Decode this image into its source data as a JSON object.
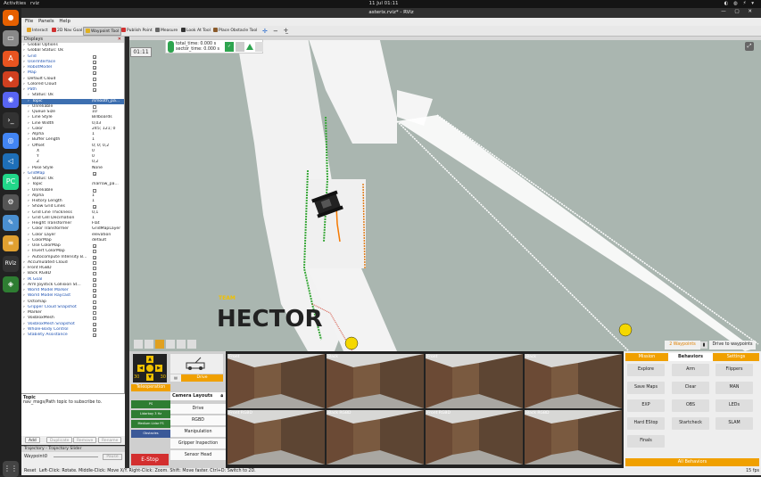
{
  "system": {
    "activities": "Activities",
    "clock": "11 Jul  01:11",
    "app_name": "rviz"
  },
  "window": {
    "title": "asterix.rviz* - RViz"
  },
  "menu": [
    "File",
    "Panels",
    "Help"
  ],
  "toolbar": [
    {
      "label": "Interact",
      "color": "#e0a020",
      "selected": false
    },
    {
      "label": "2D Nav Goal",
      "color": "#d03030",
      "selected": false
    },
    {
      "label": "Waypoint Tool",
      "color": "#e0b020",
      "selected": true
    },
    {
      "label": "Publish Point",
      "color": "#d03030",
      "selected": false
    },
    {
      "label": "Measure",
      "color": "#666666",
      "selected": false
    },
    {
      "label": "Look At Tool",
      "color": "#333333",
      "selected": false
    },
    {
      "label": "Place Obstacle Tool",
      "color": "#8a5a2a",
      "selected": false
    }
  ],
  "displays": {
    "title": "Displays",
    "rows": [
      {
        "indent": 1,
        "label": "Global Options",
        "value": "",
        "check": null,
        "blue": false
      },
      {
        "indent": 1,
        "label": "Global Status: Ok",
        "value": "",
        "check": null,
        "blue": false
      },
      {
        "indent": 1,
        "label": "Grid",
        "value": "",
        "check": true,
        "blue": true
      },
      {
        "indent": 1,
        "label": "UserInterface",
        "value": "",
        "check": true,
        "blue": true
      },
      {
        "indent": 1,
        "label": "RobotModel",
        "value": "",
        "check": true,
        "blue": true
      },
      {
        "indent": 1,
        "label": "Map",
        "value": "",
        "check": true,
        "blue": true
      },
      {
        "indent": 1,
        "label": "Default Cloud",
        "value": "",
        "check": false,
        "blue": false
      },
      {
        "indent": 1,
        "label": "Colored Cloud",
        "value": "",
        "check": false,
        "blue": false
      },
      {
        "indent": 1,
        "label": "Path",
        "value": "",
        "check": true,
        "blue": true
      },
      {
        "indent": 2,
        "label": "Status: Ok",
        "value": "",
        "check": null,
        "blue": false
      },
      {
        "indent": 2,
        "label": "Topic",
        "value": "/smooth_pa...",
        "check": null,
        "blue": false,
        "selected": true
      },
      {
        "indent": 2,
        "label": "Unreliable",
        "value": "",
        "check": false,
        "blue": false
      },
      {
        "indent": 2,
        "label": "Queue Size",
        "value": "10",
        "check": null,
        "blue": false
      },
      {
        "indent": 2,
        "label": "Line Style",
        "value": "Billboards",
        "check": null,
        "blue": false
      },
      {
        "indent": 2,
        "label": "Line Width",
        "value": "0,03",
        "check": null,
        "blue": false
      },
      {
        "indent": 2,
        "label": "Color",
        "value": "245; 121; 0",
        "check": null,
        "blue": false
      },
      {
        "indent": 2,
        "label": "Alpha",
        "value": "1",
        "check": null,
        "blue": false
      },
      {
        "indent": 2,
        "label": "Buffer Length",
        "value": "1",
        "check": null,
        "blue": false
      },
      {
        "indent": 2,
        "label": "Offset",
        "value": "0; 0; 0,2",
        "check": null,
        "blue": false
      },
      {
        "indent": 3,
        "label": "X",
        "value": "0",
        "check": null,
        "blue": false
      },
      {
        "indent": 3,
        "label": "Y",
        "value": "0",
        "check": null,
        "blue": false
      },
      {
        "indent": 3,
        "label": "Z",
        "value": "0,2",
        "check": null,
        "blue": false
      },
      {
        "indent": 2,
        "label": "Pose Style",
        "value": "None",
        "check": null,
        "blue": false
      },
      {
        "indent": 1,
        "label": "GridMap",
        "value": "",
        "check": true,
        "blue": true
      },
      {
        "indent": 2,
        "label": "Status: Ok",
        "value": "",
        "check": null,
        "blue": false
      },
      {
        "indent": 2,
        "label": "Topic",
        "value": "/narrow_pa...",
        "check": null,
        "blue": false
      },
      {
        "indent": 2,
        "label": "Unreliable",
        "value": "",
        "check": false,
        "blue": false
      },
      {
        "indent": 2,
        "label": "Alpha",
        "value": "1",
        "check": null,
        "blue": false
      },
      {
        "indent": 2,
        "label": "History Length",
        "value": "1",
        "check": null,
        "blue": false
      },
      {
        "indent": 2,
        "label": "Show Grid Lines",
        "value": "",
        "check": true,
        "blue": false
      },
      {
        "indent": 2,
        "label": "Grid Line Thickness",
        "value": "0,1",
        "check": null,
        "blue": false
      },
      {
        "indent": 2,
        "label": "Grid Cell Decimation",
        "value": "1",
        "check": null,
        "blue": false
      },
      {
        "indent": 2,
        "label": "Height Transformer",
        "value": "Flat",
        "check": null,
        "blue": false
      },
      {
        "indent": 2,
        "label": "Color Transformer",
        "value": "GridMapLayer",
        "check": null,
        "blue": false
      },
      {
        "indent": 2,
        "label": "Color Layer",
        "value": "elevation",
        "check": null,
        "blue": false
      },
      {
        "indent": 2,
        "label": "ColorMap",
        "value": "default",
        "check": null,
        "blue": false
      },
      {
        "indent": 2,
        "label": "Use ColorMap",
        "value": "",
        "check": true,
        "blue": false
      },
      {
        "indent": 2,
        "label": "Invert ColorMap",
        "value": "",
        "check": false,
        "blue": false
      },
      {
        "indent": 2,
        "label": "Autocompute Intensity B...",
        "value": "",
        "check": true,
        "blue": false
      },
      {
        "indent": 1,
        "label": "Accumulated Cloud",
        "value": "",
        "check": false,
        "blue": false
      },
      {
        "indent": 1,
        "label": "Front RGBD",
        "value": "",
        "check": false,
        "blue": false
      },
      {
        "indent": 1,
        "label": "Back RGBD",
        "value": "",
        "check": false,
        "blue": false
      },
      {
        "indent": 1,
        "label": "IK Goal",
        "value": "",
        "check": true,
        "blue": true
      },
      {
        "indent": 1,
        "label": "Arm Joystick Collision St...",
        "value": "",
        "check": false,
        "blue": false
      },
      {
        "indent": 1,
        "label": "World Model Marker",
        "value": "",
        "check": true,
        "blue": true
      },
      {
        "indent": 1,
        "label": "World Model Raycast",
        "value": "",
        "check": true,
        "blue": true
      },
      {
        "indent": 1,
        "label": "Octomap",
        "value": "",
        "check": false,
        "blue": false
      },
      {
        "indent": 1,
        "label": "Gripper Cloud Snapshot",
        "value": "",
        "check": true,
        "blue": true
      },
      {
        "indent": 1,
        "label": "Marker",
        "value": "",
        "check": false,
        "blue": false
      },
      {
        "indent": 1,
        "label": "VoxbloxMesh",
        "value": "",
        "check": false,
        "blue": false
      },
      {
        "indent": 1,
        "label": "VoxbloxMesh Snapshot",
        "value": "",
        "check": true,
        "blue": true
      },
      {
        "indent": 1,
        "label": "Whole-Body Control",
        "value": "",
        "check": true,
        "blue": true
      },
      {
        "indent": 1,
        "label": "Stability Assistance",
        "value": "",
        "check": true,
        "blue": true
      }
    ]
  },
  "help": {
    "title": "Topic",
    "text": "nav_msgs/Path topic to subscribe to."
  },
  "panel_buttons": [
    "Add",
    "Duplicate",
    "Remove",
    "Rename"
  ],
  "trajectory": {
    "title": "Trajectory - Trajectory Slider",
    "label": "Waypoint:",
    "value": "0",
    "button": "Pause"
  },
  "status": {
    "reset": "Reset",
    "hint": "Left-Click: Rotate. Middle-Click: Move X/Y. Right-Click: Zoom. Shift: Move faster. Ctrl+D: Switch to 2D.",
    "fps": "15 fps"
  },
  "viewport": {
    "fps_badge": "01:11",
    "total_time": "total_time: 0.000 s",
    "sector_time": "sector_time: 0.000 s",
    "logo_team": "TEAM",
    "logo_name": "HECTOR"
  },
  "controls": {
    "teleop": "Teleoperation",
    "drive": "Drive",
    "camera_layouts": "Camera Layouts",
    "layouts": [
      "Drive",
      "RGBD",
      "Manipulation",
      "Gripper Inspection",
      "Sensor Head"
    ],
    "estop": "E-Stop",
    "speed_left": "30",
    "speed_right": "30",
    "mini": [
      "PS",
      "Lidarboy 3 Hz",
      "Medium Lidar FS",
      "Obstacles"
    ]
  },
  "cameras": [
    {
      "label": "Front"
    },
    {
      "label": "Back"
    },
    {
      "label": "Front"
    },
    {
      "label": "Back"
    },
    {
      "label": "Front RGBD"
    },
    {
      "label": "Back RGBD"
    },
    {
      "label": "Front RGBD"
    },
    {
      "label": "Back RGBD"
    }
  ],
  "mission": {
    "waypoints": "2 Waypoints",
    "drive_to": "Drive to waypoints",
    "tabs": [
      "Mission",
      "Behaviors",
      "Settings"
    ],
    "buttons": [
      "Explore",
      "Arm",
      "Flippers",
      "Save Maps",
      "Clear",
      "MAN",
      "EXP",
      "OBS",
      "LEDs",
      "Hard EStop",
      "Startcheck",
      "SLAM",
      "Finals"
    ],
    "all_behaviors": "All Behaviors"
  }
}
